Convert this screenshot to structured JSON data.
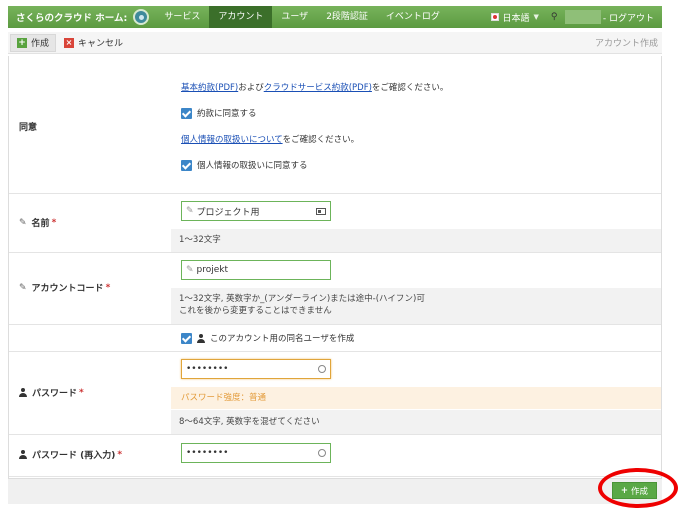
{
  "topbar": {
    "brand": "さくらのクラウド ホーム:",
    "nav": [
      "サービス",
      "アカウント",
      "ユーザ",
      "2段階認証",
      "イベントログ"
    ],
    "language": "日本語",
    "logout": "- ログアウト"
  },
  "toolbar": {
    "create_label": "作成",
    "cancel_label": "キャンセル",
    "page_label": "アカウント作成"
  },
  "consent": {
    "label": "同意",
    "terms_link1": "基本約款(PDF)",
    "terms_mid": "および",
    "terms_link2": "クラウドサービス約款(PDF)",
    "terms_suffix": "をご確認ください。",
    "agree_terms": "約款に同意する",
    "privacy_link": "個人情報の取扱いについて",
    "privacy_suffix": "をご確認ください。",
    "agree_privacy": "個人情報の取扱いに同意する"
  },
  "name_field": {
    "label": "名前",
    "required": "*",
    "value": "プロジェクト用",
    "hint": "1〜32文字"
  },
  "code_field": {
    "label": "アカウントコード",
    "required": "*",
    "value": "projekt",
    "hint_line1": "1〜32文字, 英数字か_(アンダーライン)または途中-(ハイフン)可",
    "hint_line2": "これを後から変更することはできません"
  },
  "same_user": {
    "label": "このアカウント用の同名ユーザを作成"
  },
  "password_field": {
    "label": "パスワード",
    "required": "*",
    "value": "••••••••",
    "strength": "パスワード強度：普通",
    "hint": "8〜64文字, 英数字を混ぜてください"
  },
  "password_confirm": {
    "label": "パスワード (再入力)",
    "required": "*",
    "value": "••••••••"
  },
  "footer": {
    "submit_label": "作成"
  },
  "colors": {
    "brand_green": "#5c9a41",
    "link_blue": "#1a4fb5",
    "required_red": "#cc3333",
    "highlight_red": "#ee0000"
  }
}
